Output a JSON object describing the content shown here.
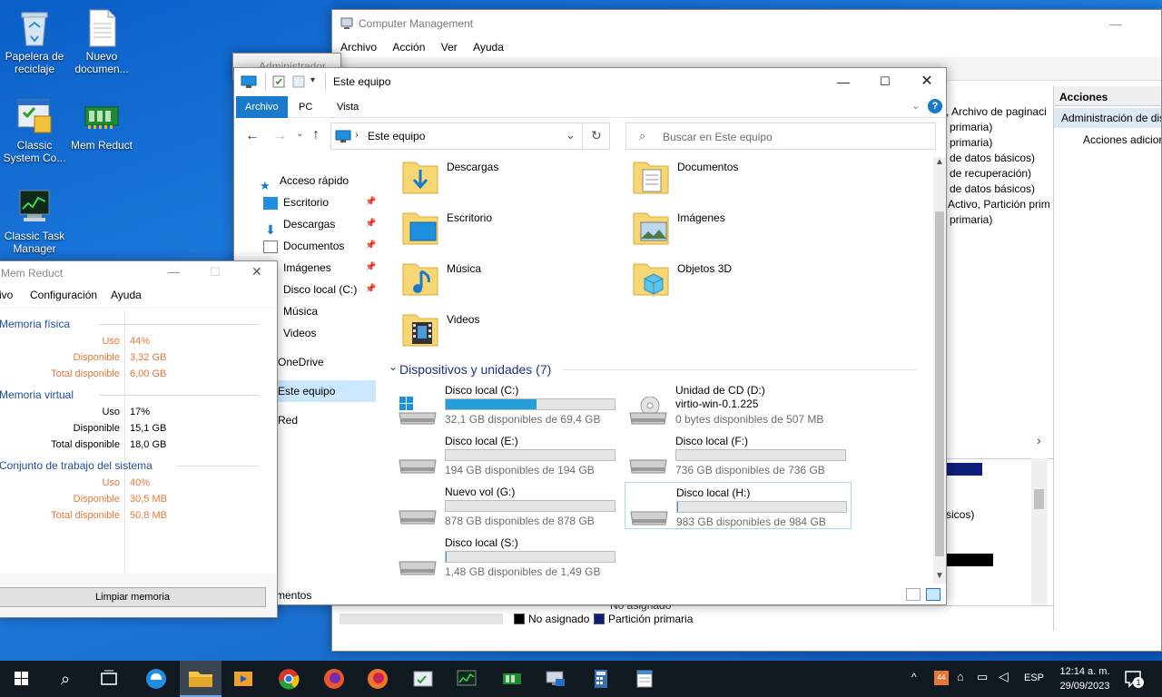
{
  "desktop": {
    "icons": [
      {
        "label": "Papelera de reciclaje"
      },
      {
        "label": "Nuevo documen..."
      },
      {
        "label": "Classic System Co..."
      },
      {
        "label": "Mem Reduct"
      },
      {
        "label": "Classic Task Manager"
      }
    ]
  },
  "computer_management": {
    "title": "Computer Management",
    "menu": [
      "Archivo",
      "Acción",
      "Ver",
      "Ayuda"
    ],
    "behind_title": "Administrador",
    "list_lines": [
      ", Archivo de paginaci",
      "primaria)",
      "primaria)",
      "de datos básicos)",
      "de recuperación)",
      "de datos básicos)",
      "Activo, Partición prim",
      "primaria)"
    ],
    "actions_header": "Acciones",
    "actions_item": "Administración de dis",
    "actions_more": "Acciones adicior",
    "lower_text": "sicos)",
    "legend_unassigned": "No asignado",
    "legend_unassigned_top": "No asignado",
    "legend_primary": "Partición primaria"
  },
  "explorer": {
    "title": "Este equipo",
    "tabs": [
      "Archivo",
      "PC",
      "Vista"
    ],
    "address": "Este equipo",
    "search_placeholder": "Buscar en Este equipo",
    "nav": {
      "quick_access": "Acceso rápido",
      "items": [
        "Escritorio",
        "Descargas",
        "Documentos",
        "Imágenes",
        "Disco local (C:)",
        "Música",
        "Videos"
      ],
      "onedrive": "OneDrive",
      "this_pc": "Este equipo",
      "network": "Red"
    },
    "folders": [
      "Descargas",
      "Documentos",
      "Escritorio",
      "Imágenes",
      "Música",
      "Objetos 3D",
      "Videos"
    ],
    "devices_header": "Dispositivos y unidades (7)",
    "drives": [
      {
        "name": "Disco local (C:)",
        "free_text": "32,1 GB disponibles de 69,4 GB",
        "used_fraction": 0.54
      },
      {
        "name": "Unidad de CD (D:)",
        "subtitle": "virtio-win-0.1.225",
        "free_text": "0 bytes disponibles de 507 MB"
      },
      {
        "name": "Disco local (E:)",
        "free_text": "194 GB disponibles de 194 GB",
        "used_fraction": 0.0
      },
      {
        "name": "Disco local (F:)",
        "free_text": "736 GB disponibles de 736 GB",
        "used_fraction": 0.0
      },
      {
        "name": "Nuevo vol (G:)",
        "free_text": "878 GB disponibles de 878 GB",
        "used_fraction": 0.0
      },
      {
        "name": "Disco local (H:)",
        "free_text": "983 GB disponibles de 984 GB",
        "used_fraction": 0.001
      },
      {
        "name": "Disco local (S:)",
        "free_text": "1,48 GB disponibles de 1,49 GB",
        "used_fraction": 0.007
      }
    ],
    "status_left": "mentos"
  },
  "mem_reduct": {
    "title": "Mem Reduct",
    "menu": [
      "ivo",
      "Configuración",
      "Ayuda"
    ],
    "sections": [
      {
        "title": "Memoria física",
        "rows": [
          [
            "Uso",
            "44%"
          ],
          [
            "Disponible",
            "3,32 GB"
          ],
          [
            "Total disponible",
            "6,00 GB"
          ]
        ],
        "color": "#e8763a"
      },
      {
        "title": "Memoria virtual",
        "rows": [
          [
            "Uso",
            "17%"
          ],
          [
            "Disponible",
            "15,1 GB"
          ],
          [
            "Total disponible",
            "18,0 GB"
          ]
        ],
        "color": "#000000"
      },
      {
        "title": "Conjunto de trabajo del sistema",
        "rows": [
          [
            "Uso",
            "40%"
          ],
          [
            "Disponible",
            "30,5 MB"
          ],
          [
            "Total disponible",
            "50,8 MB"
          ]
        ],
        "color": "#e8763a"
      }
    ],
    "clean_button": "Limpiar memoria"
  },
  "taskbar": {
    "lang": "ESP",
    "time": "12:14 a. m.",
    "date": "29/09/2023",
    "notification_count": "1",
    "apps": [
      "start",
      "search",
      "task-view",
      "edge",
      "file-explorer",
      "media",
      "chrome",
      "firefox",
      "firefox-dev",
      "system-config",
      "task-manager",
      "mem-reduct",
      "computer-management",
      "calculator",
      "notepad"
    ]
  },
  "colors": {
    "accent": "#0078d7",
    "drive_fill": "#26a0da",
    "mem_warn": "#e8763a"
  }
}
